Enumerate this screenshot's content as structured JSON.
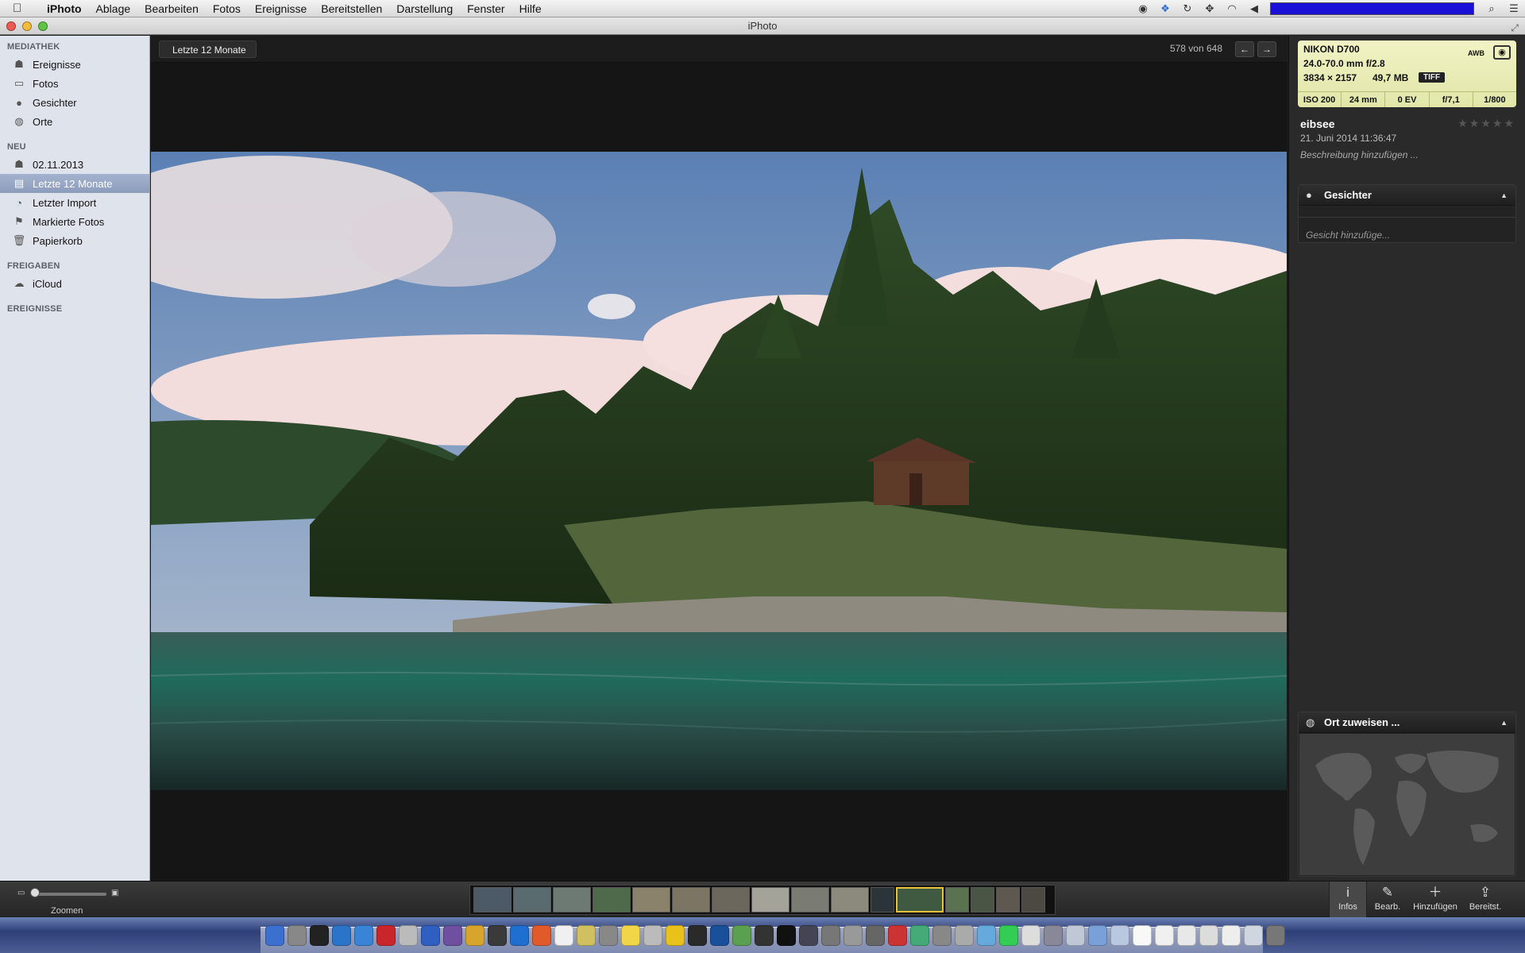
{
  "menubar": {
    "app": "iPhoto",
    "items": [
      "Ablage",
      "Bearbeiten",
      "Fotos",
      "Ereignisse",
      "Bereitstellen",
      "Darstellung",
      "Fenster",
      "Hilfe"
    ]
  },
  "window": {
    "title": "iPhoto"
  },
  "sidebar": {
    "sections": [
      {
        "header": "MEDIATHEK",
        "items": [
          {
            "label": "Ereignisse",
            "icon": "events-icon"
          },
          {
            "label": "Fotos",
            "icon": "photos-icon"
          },
          {
            "label": "Gesichter",
            "icon": "faces-icon"
          },
          {
            "label": "Orte",
            "icon": "places-icon"
          }
        ]
      },
      {
        "header": "NEU",
        "items": [
          {
            "label": "02.11.2013",
            "icon": "event-icon"
          },
          {
            "label": "Letzte 12 Monate",
            "icon": "calendar-icon",
            "selected": true
          },
          {
            "label": "Letzter Import",
            "icon": "import-icon"
          },
          {
            "label": "Markierte Fotos",
            "icon": "flag-icon"
          },
          {
            "label": "Papierkorb",
            "icon": "trash-icon"
          }
        ]
      },
      {
        "header": "FREIGABEN",
        "items": [
          {
            "label": "iCloud",
            "icon": "cloud-icon"
          }
        ]
      },
      {
        "header": "EREIGNISSE",
        "items": []
      }
    ]
  },
  "viewer": {
    "breadcrumb": "Letzte 12 Monate",
    "counter": "578 von 648",
    "prev_icon": "←",
    "next_icon": "→"
  },
  "info": {
    "camera": "NIKON D700",
    "lens": "24.0-70.0 mm f/2.8",
    "dimensions": "3834 × 2157",
    "size": "49,7 MB",
    "format": "TIFF",
    "wb": "AWB",
    "iso": "ISO 200",
    "focal": "24 mm",
    "ev": "0 EV",
    "aperture": "f/7,1",
    "shutter": "1/800",
    "title": "eibsee",
    "date": "21. Juni 2014 11:36:47",
    "description_placeholder": "Beschreibung hinzufügen ...",
    "rating_stars": "★★★★★",
    "faces_header": "Gesichter",
    "faces_add": "Gesicht hinzufüge...",
    "place_header": "Ort zuweisen ..."
  },
  "toolbar": {
    "zoom_label": "Zoomen",
    "buttons": [
      {
        "label": "Infos",
        "icon": "i"
      },
      {
        "label": "Bearb.",
        "icon": "✎"
      },
      {
        "label": "Hinzufügen",
        "icon": "＋"
      },
      {
        "label": "Bereitst.",
        "icon": "⇪"
      }
    ]
  },
  "colors": {
    "sidebar_bg": "#dfe4ec",
    "selection": "#8c9cbb",
    "exif_bg": "#e9edb6",
    "thumb_selected": "#e8c23a"
  }
}
